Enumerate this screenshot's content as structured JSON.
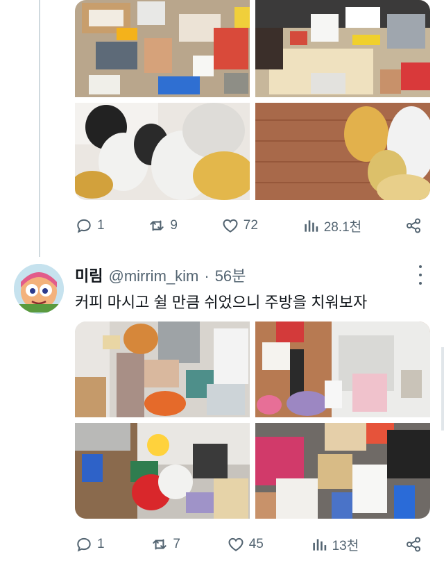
{
  "previous_tweet": {
    "stats": {
      "replies": "1",
      "retweets": "9",
      "likes": "72",
      "views": "28.1천"
    }
  },
  "tweet": {
    "display_name": "미림",
    "handle": "@mirrim_kim",
    "separator": "·",
    "time": "56분",
    "text": "커피 마시고 쉴 만큼 쉬었으니 주방을 치워보자",
    "stats": {
      "replies": "1",
      "retweets": "7",
      "likes": "45",
      "views": "13천"
    }
  },
  "icons": [
    "reply-icon",
    "retweet-icon",
    "like-icon",
    "views-icon",
    "share-icon",
    "more-icon"
  ],
  "colors": {
    "text_primary": "#0f1419",
    "text_secondary": "#536471",
    "thread_line": "#cfd9de"
  }
}
